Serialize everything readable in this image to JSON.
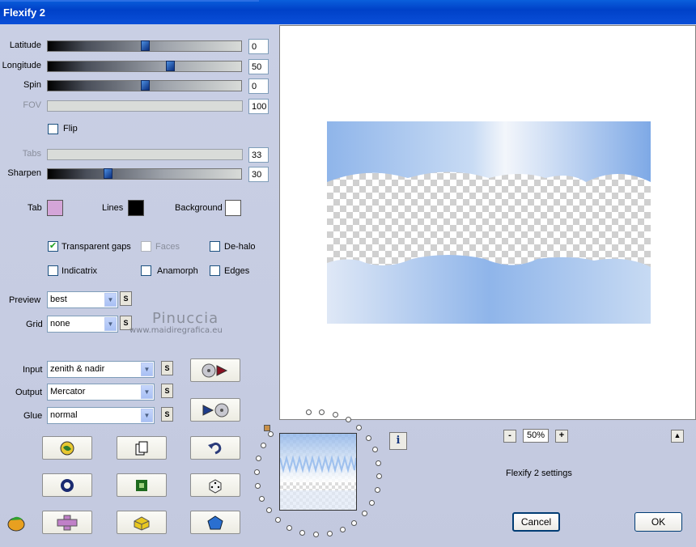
{
  "window": {
    "title": "Flexify 2"
  },
  "sliders": [
    {
      "label": "Latitude",
      "value": "0",
      "enabled": true,
      "fraction": 0.5
    },
    {
      "label": "Longitude",
      "value": "50",
      "enabled": true,
      "fraction": 0.63
    },
    {
      "label": "Spin",
      "value": "0",
      "enabled": true,
      "fraction": 0.5
    },
    {
      "label": "FOV",
      "value": "100",
      "enabled": false
    },
    {
      "label": "Tabs",
      "value": "33",
      "enabled": false
    },
    {
      "label": "Sharpen",
      "value": "30",
      "enabled": true,
      "fraction": 0.3
    }
  ],
  "flip": {
    "label": "Flip",
    "checked": false
  },
  "colors": {
    "tab": {
      "label": "Tab",
      "color": "#d4a5d8"
    },
    "lines": {
      "label": "Lines",
      "color": "#000000"
    },
    "background": {
      "label": "Background",
      "color": "#ffffff"
    }
  },
  "options": {
    "transparent_gaps": {
      "label": "Transparent gaps",
      "checked": true
    },
    "faces": {
      "label": "Faces",
      "checked": false,
      "enabled": false
    },
    "dehalo": {
      "label": "De-halo",
      "checked": false
    },
    "indicatrix": {
      "label": "Indicatrix",
      "checked": false
    },
    "anamorph": {
      "label": "Anamorph",
      "checked": false
    },
    "edges": {
      "label": "Edges",
      "checked": false
    }
  },
  "preview_select": {
    "label": "Preview",
    "value": "best"
  },
  "grid_select": {
    "label": "Grid",
    "value": "none"
  },
  "watermark": {
    "line1": "Pinuccia",
    "line2": "www.maidiregrafica.eu"
  },
  "input_select": {
    "label": "Input",
    "value": "zenith & nadir"
  },
  "output_select": {
    "label": "Output",
    "value": "Mercator"
  },
  "glue_select": {
    "label": "Glue",
    "value": "normal"
  },
  "s_label": "S",
  "zoom": {
    "value": "50%",
    "minus": "-",
    "plus": "+"
  },
  "info_label": "i",
  "status_text": "Flexify 2 settings",
  "buttons": {
    "cancel": "Cancel",
    "ok": "OK"
  },
  "accent": "#0041c8"
}
